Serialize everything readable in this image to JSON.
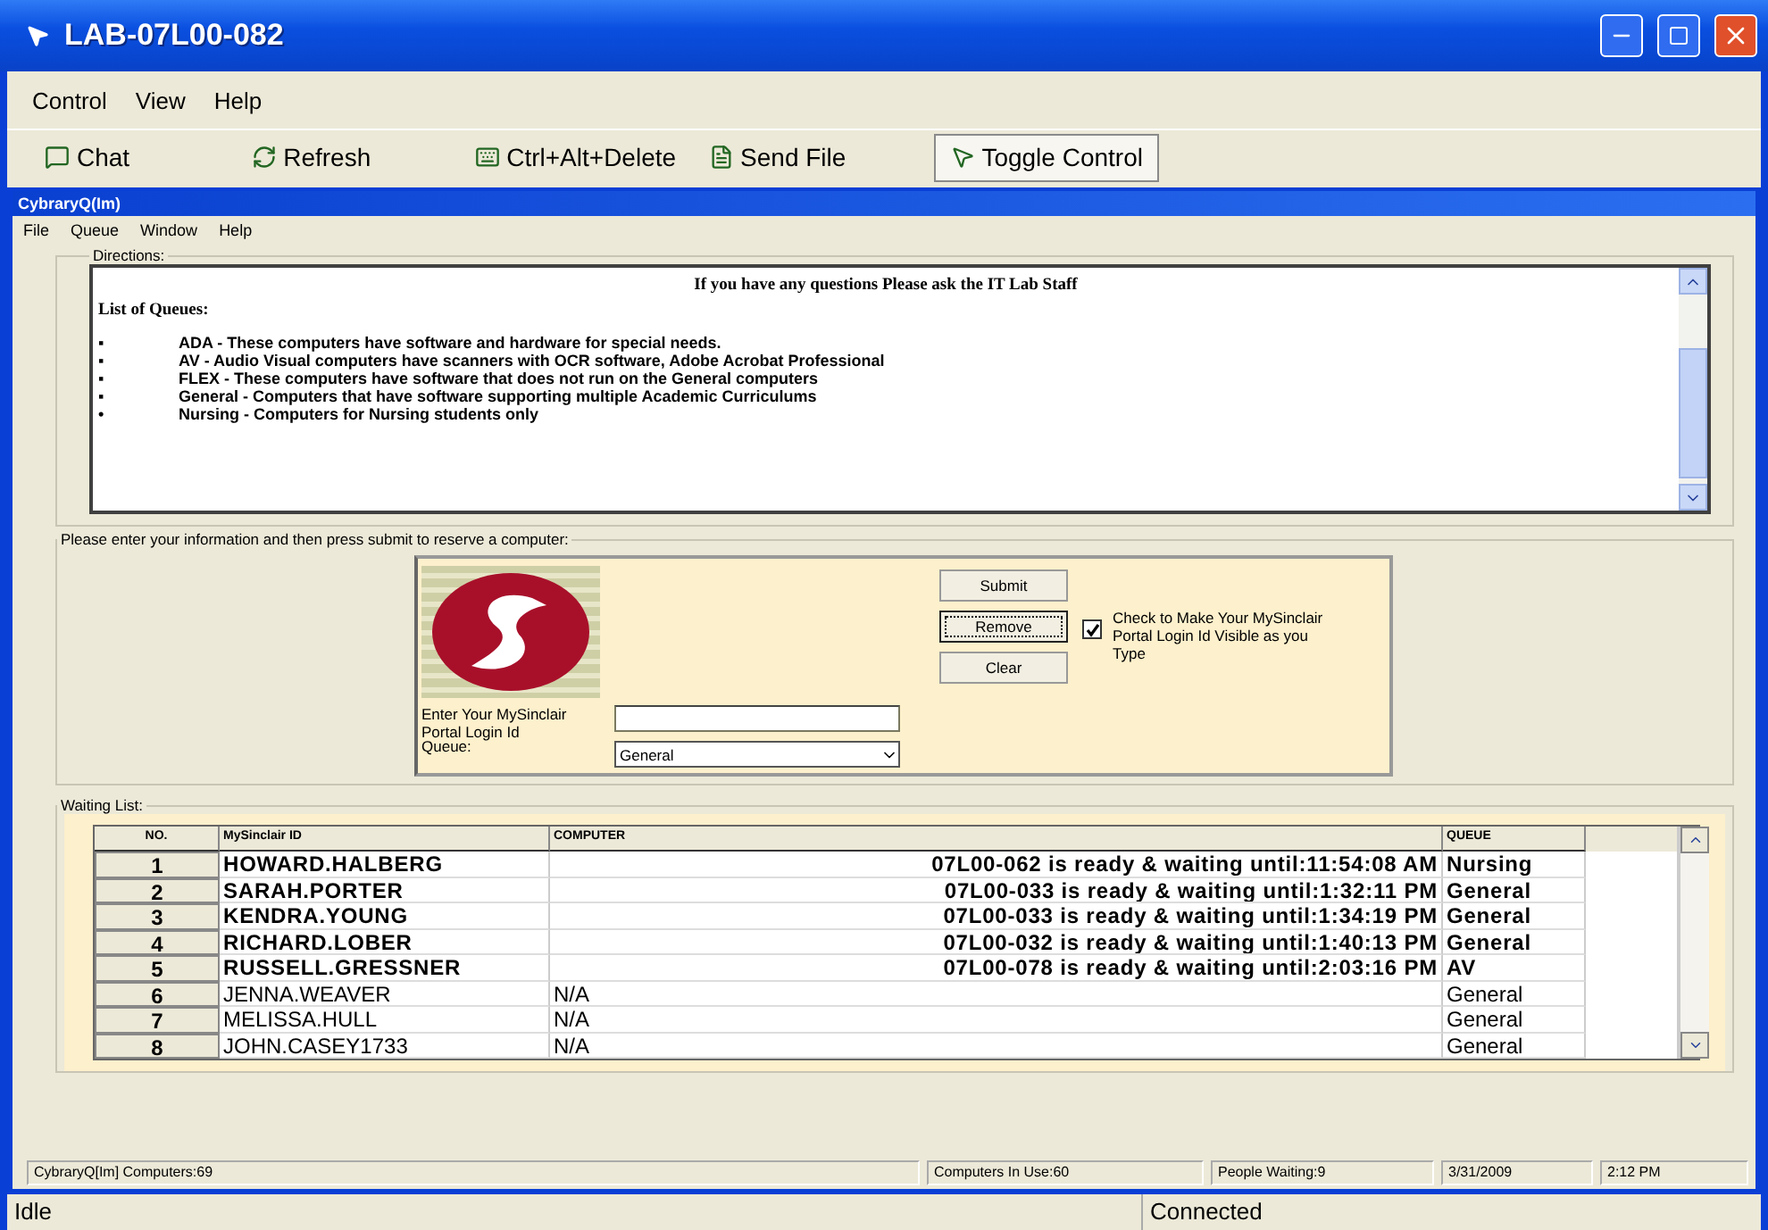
{
  "window": {
    "title": "LAB-07L00-082"
  },
  "menu": [
    "Control",
    "View",
    "Help"
  ],
  "toolbar": [
    {
      "label": "Chat",
      "kind": "chat",
      "selected": false
    },
    {
      "label": "Refresh",
      "kind": "refresh",
      "selected": false
    },
    {
      "label": "Ctrl+Alt+Delete",
      "kind": "keys",
      "selected": false
    },
    {
      "label": "Send File",
      "kind": "file",
      "selected": false
    },
    {
      "label": "Toggle Control",
      "kind": "pointer",
      "selected": true
    }
  ],
  "app": {
    "title": "CybraryQ(Im)",
    "menu": [
      "File",
      "Queue",
      "Window",
      "Help"
    ]
  },
  "directions": {
    "legend": "Directions:",
    "heading": "If you have any questions Please ask the IT Lab Staff",
    "list_title": "List of Queues:",
    "items": [
      {
        "bullet": "▪",
        "text": "ADA - These computers have software and hardware for special needs."
      },
      {
        "bullet": "▪",
        "text": "AV - Audio Visual computers have scanners with OCR software, Adobe Acrobat Professional"
      },
      {
        "bullet": "▪",
        "text": "FLEX - These computers have software that does not run on the General computers"
      },
      {
        "bullet": "▪",
        "text": "General - Computers that have software supporting multiple Academic Curriculums"
      },
      {
        "bullet": "•",
        "text": "Nursing - Computers for Nursing students only"
      }
    ]
  },
  "form": {
    "legend": "Please enter your information and then press submit to reserve a computer:",
    "buttons": [
      {
        "label": "Submit",
        "focused": false
      },
      {
        "label": "Remove",
        "focused": true
      },
      {
        "label": "Clear",
        "focused": false
      }
    ],
    "checkbox": {
      "label": "Check to Make Your MySinclair Portal Login Id Visible as you Type",
      "checked": true
    },
    "login_label": "Enter Your MySinclair Portal Login Id",
    "queue_label": "Queue:",
    "queue_value": "General"
  },
  "waiting_list": {
    "legend": "Waiting List:",
    "columns": [
      "NO.",
      "MySinclair ID",
      "COMPUTER",
      "QUEUE"
    ],
    "rows": [
      {
        "no": "1",
        "id": "HOWARD.HALBERG",
        "computer": "07L00-062 is ready & waiting until:11:54:08 AM",
        "queue": "Nursing",
        "ready": true
      },
      {
        "no": "2",
        "id": "SARAH.PORTER",
        "computer": "07L00-033 is ready & waiting until:1:32:11 PM",
        "queue": "General",
        "ready": true
      },
      {
        "no": "3",
        "id": "KENDRA.YOUNG",
        "computer": "07L00-033 is ready & waiting until:1:34:19 PM",
        "queue": "General",
        "ready": true
      },
      {
        "no": "4",
        "id": "RICHARD.LOBER",
        "computer": "07L00-032 is ready & waiting until:1:40:13 PM",
        "queue": "General",
        "ready": true
      },
      {
        "no": "5",
        "id": "RUSSELL.GRESSNER",
        "computer": "07L00-078 is ready & waiting until:2:03:16 PM",
        "queue": "AV",
        "ready": true
      },
      {
        "no": "6",
        "id": "JENNA.WEAVER",
        "computer": "N/A",
        "queue": "General",
        "ready": false
      },
      {
        "no": "7",
        "id": "MELISSA.HULL",
        "computer": "N/A",
        "queue": "General",
        "ready": false
      },
      {
        "no": "8",
        "id": "JOHN.CASEY1733",
        "computer": "N/A",
        "queue": "General",
        "ready": false
      }
    ]
  },
  "app_status": [
    "CybraryQ[Im] Computers:69",
    "Computers In Use:60",
    "People Waiting:9",
    "3/31/2009",
    "2:12 PM"
  ],
  "status_bar": {
    "left": "Idle",
    "right": "Connected"
  }
}
